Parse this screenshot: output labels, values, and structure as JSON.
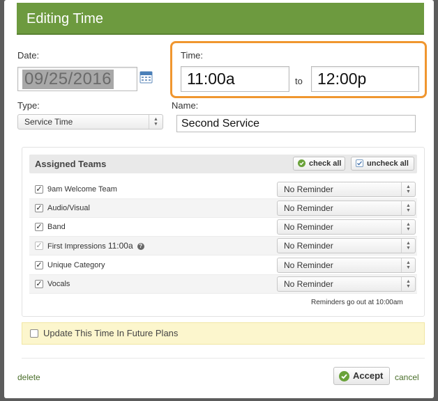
{
  "header": {
    "title": "Editing Time"
  },
  "date": {
    "label": "Date:",
    "value": "09/25/2016"
  },
  "time": {
    "label": "Time:",
    "start": "11:00a",
    "to": "to",
    "end": "12:00p"
  },
  "type": {
    "label": "Type:",
    "value": "Service Time"
  },
  "name": {
    "label": "Name:",
    "value": "Second Service"
  },
  "teams": {
    "title": "Assigned Teams",
    "check_all": "check all",
    "uncheck_all": "uncheck all",
    "rows": [
      {
        "name": "9am Welcome Team",
        "reminder": "No Reminder",
        "checked": true
      },
      {
        "name": "Audio/Visual",
        "reminder": "No Reminder",
        "checked": true
      },
      {
        "name": "Band",
        "reminder": "No Reminder",
        "checked": true
      },
      {
        "name": "First Impressions",
        "time": "11:00a",
        "reminder": "No Reminder",
        "checked": true,
        "disabled": true
      },
      {
        "name": "Unique Category",
        "reminder": "No Reminder",
        "checked": true
      },
      {
        "name": "Vocals",
        "reminder": "No Reminder",
        "checked": true
      }
    ],
    "reminder_note": "Reminders go out at 10:00am"
  },
  "future": {
    "label": "Update This Time In Future Plans",
    "checked": false
  },
  "footer": {
    "delete": "delete",
    "accept": "Accept",
    "cancel": "cancel"
  },
  "colors": {
    "header": "#6d9a3f",
    "highlight": "#f0962f",
    "future_bg": "#fcf6cd"
  }
}
